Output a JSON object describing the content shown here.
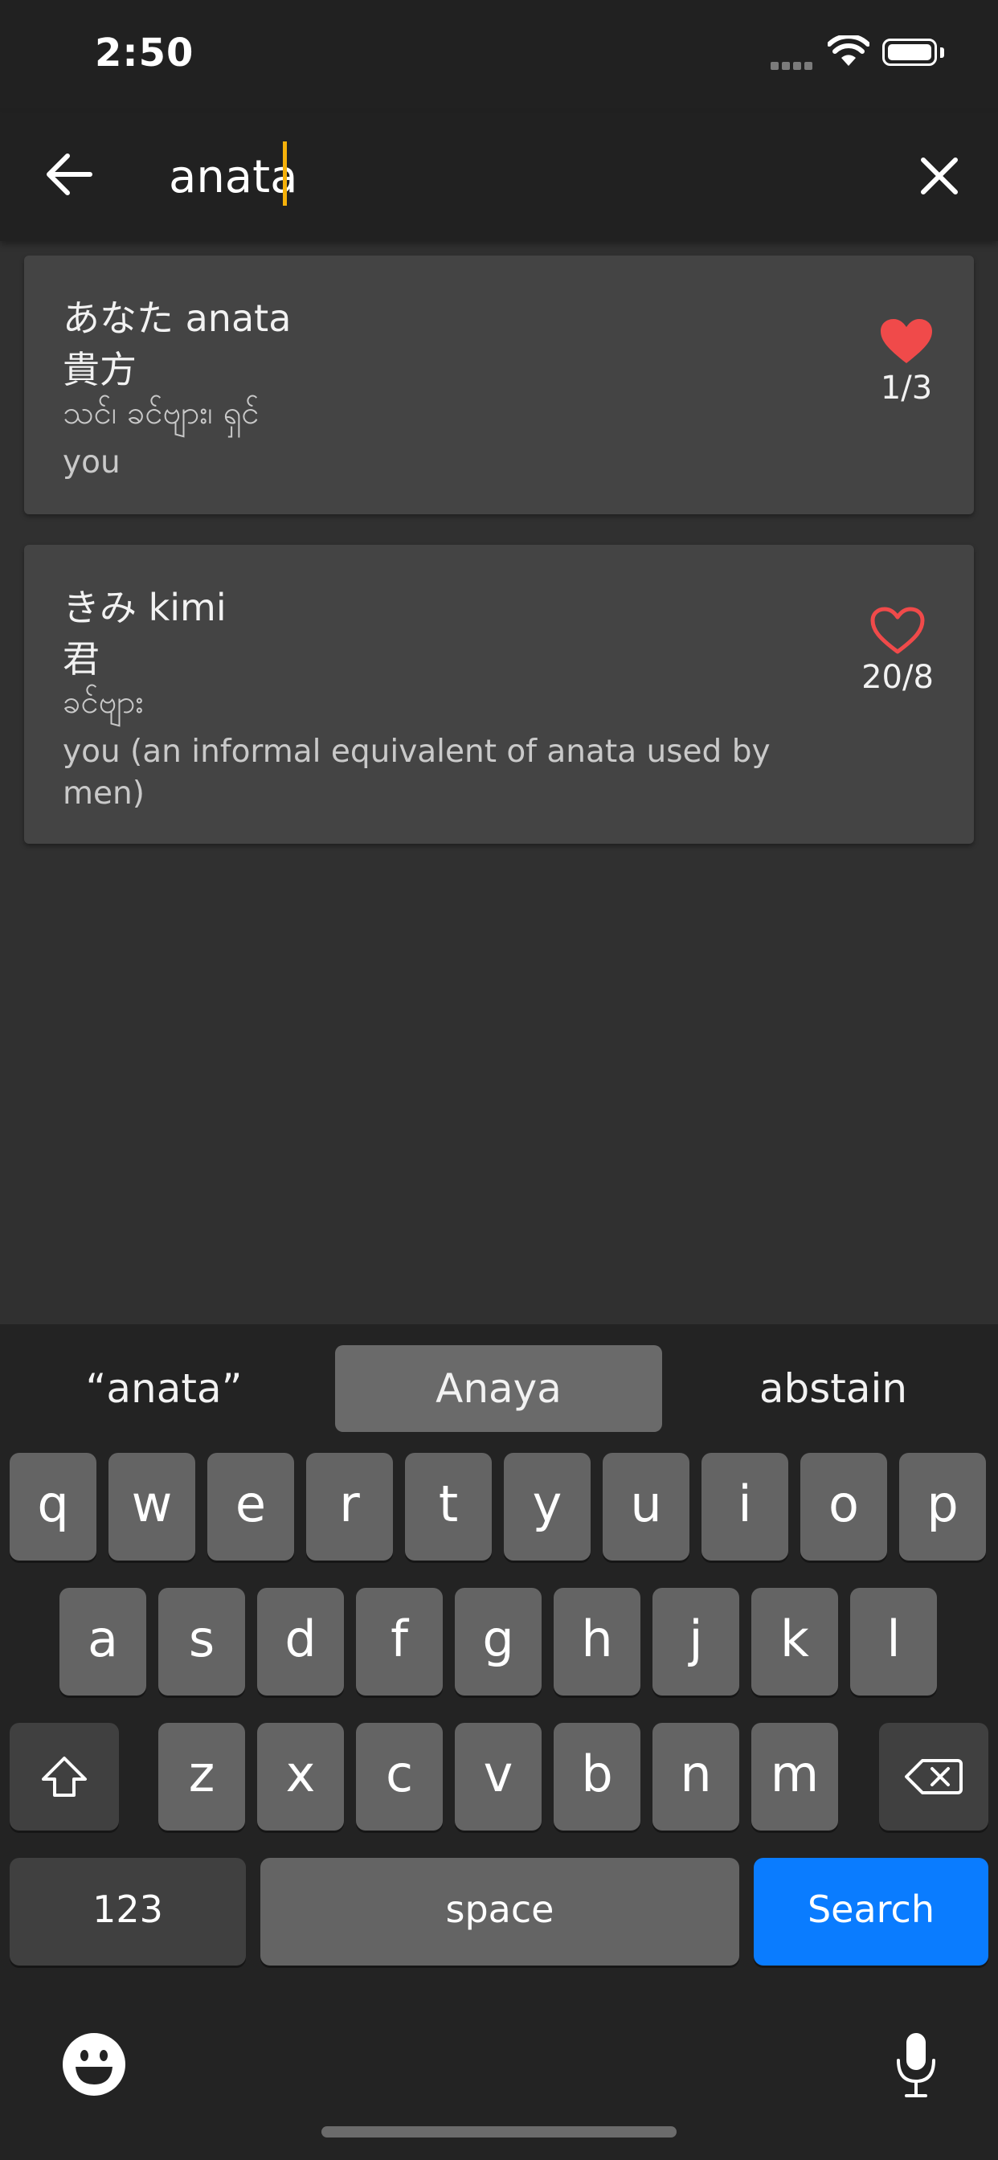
{
  "status_bar": {
    "time": "2:50"
  },
  "search": {
    "query": "anata"
  },
  "results": [
    {
      "kana_romaji": "あなた anata",
      "kanji": "貴方",
      "burmese": "သင်၊ ခင်ဗျား၊ ရှင်",
      "meaning": "you",
      "favorited": true,
      "count": "1/3"
    },
    {
      "kana_romaji": "きみ kimi",
      "kanji": "君",
      "burmese": "ခင်ဗျား",
      "meaning": "you (an informal equivalent of anata used by men)",
      "favorited": false,
      "count": "20/8"
    }
  ],
  "keyboard": {
    "suggestions": [
      "“anata”",
      "Anaya",
      "abstain"
    ],
    "row1": [
      "q",
      "w",
      "e",
      "r",
      "t",
      "y",
      "u",
      "i",
      "o",
      "p"
    ],
    "row2": [
      "a",
      "s",
      "d",
      "f",
      "g",
      "h",
      "j",
      "k",
      "l"
    ],
    "row3": [
      "z",
      "x",
      "c",
      "v",
      "b",
      "n",
      "m"
    ],
    "numbers_label": "123",
    "space_label": "space",
    "search_label": "Search"
  },
  "colors": {
    "accent_heart": "#f04a4a",
    "caret": "#f5b10a",
    "search_key": "#0a7cff"
  },
  "icons": [
    "back-arrow-icon",
    "close-icon",
    "heart-filled-icon",
    "heart-outline-icon",
    "shift-icon",
    "backspace-icon",
    "emoji-icon",
    "microphone-icon",
    "wifi-icon",
    "battery-icon"
  ]
}
